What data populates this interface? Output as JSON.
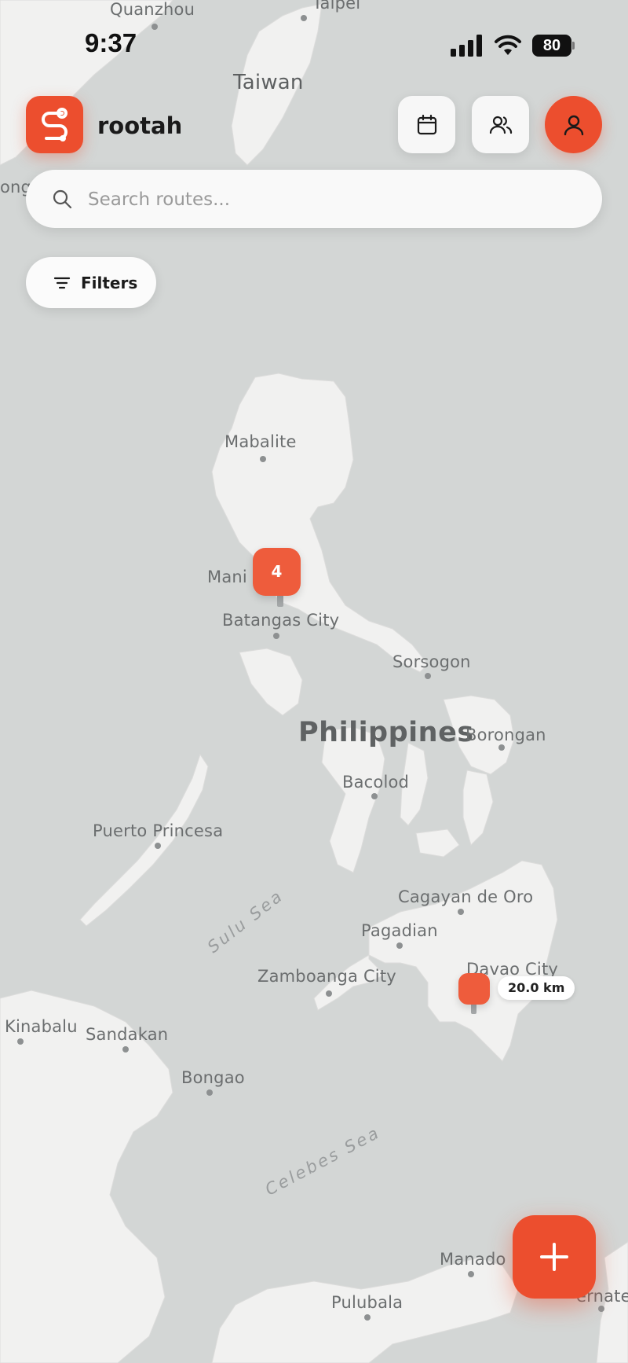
{
  "status_bar": {
    "time": "9:37",
    "battery": "80"
  },
  "header": {
    "brand": "rootah",
    "colors": {
      "accent": "#ec4e2e",
      "button_bg": "#f7f7f7"
    },
    "icons": [
      "route-logo-icon",
      "calendar-icon",
      "users-icon",
      "user-icon"
    ]
  },
  "search": {
    "placeholder": "Search routes...",
    "value": ""
  },
  "filters": {
    "label": "Filters"
  },
  "map": {
    "country": "Philippines",
    "places": {
      "quanzhou": "Quanzhou",
      "taipei": "Taipei",
      "taiwan": "Taiwan",
      "hong_kong_partial": "ong",
      "mabalite": "Mabalite",
      "manila_partial": "Mani",
      "batangas": "Batangas City",
      "sorsogon": "Sorsogon",
      "borongan": "Borongan",
      "bacolod": "Bacolod",
      "puerto_princesa": "Puerto Princesa",
      "cagayan_de_oro": "Cagayan de Oro",
      "pagadian": "Pagadian",
      "davao": "Davao City",
      "zamboanga": "Zamboanga City",
      "kinabalu": "Kinabalu",
      "sandakan": "Sandakan",
      "bongao": "Bongao",
      "manado": "Manado",
      "pulubala": "Pulubala",
      "ternate_partial": "ernate"
    },
    "seas": {
      "sulu": "Sulu Sea",
      "celebes": "Celebes Sea"
    },
    "cluster_count": "4",
    "distance_label": "20.0 km"
  },
  "fab": {
    "icon": "plus-icon"
  }
}
